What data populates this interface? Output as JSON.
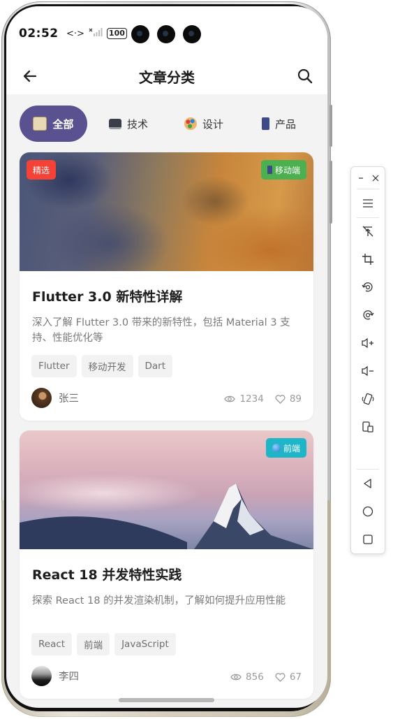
{
  "status_bar": {
    "time": "02:52",
    "signal": "<·>",
    "battery": "100"
  },
  "app_bar": {
    "title": "文章分类"
  },
  "categories": [
    {
      "label": "全部",
      "icon": "clipboard-icon",
      "active": true
    },
    {
      "label": "技术",
      "icon": "laptop-icon",
      "active": false
    },
    {
      "label": "设计",
      "icon": "palette-icon",
      "active": false
    },
    {
      "label": "产品",
      "icon": "phone-icon",
      "active": false
    }
  ],
  "articles": [
    {
      "featured_badge": "精选",
      "category_badge": "移动端",
      "category_color": "#4caf50",
      "title": "Flutter 3.0 新特性详解",
      "description": "深入了解 Flutter 3.0 带来的新特性，包括 Material 3 支持、性能优化等",
      "tags": [
        "Flutter",
        "移动开发",
        "Dart"
      ],
      "author": "张三",
      "views": "1234",
      "likes": "89"
    },
    {
      "featured_badge": "",
      "category_badge": "前端",
      "category_color": "#1fb5c9",
      "title": "React 18 并发特性实践",
      "description": "探索 React 18 的并发渲染机制，了解如何提升应用性能",
      "tags": [
        "React",
        "前端",
        "JavaScript"
      ],
      "author": "李四",
      "views": "856",
      "likes": "67"
    }
  ],
  "colors": {
    "accent": "#5a5290",
    "featured": "#f44336",
    "background": "#f3f3f4"
  }
}
